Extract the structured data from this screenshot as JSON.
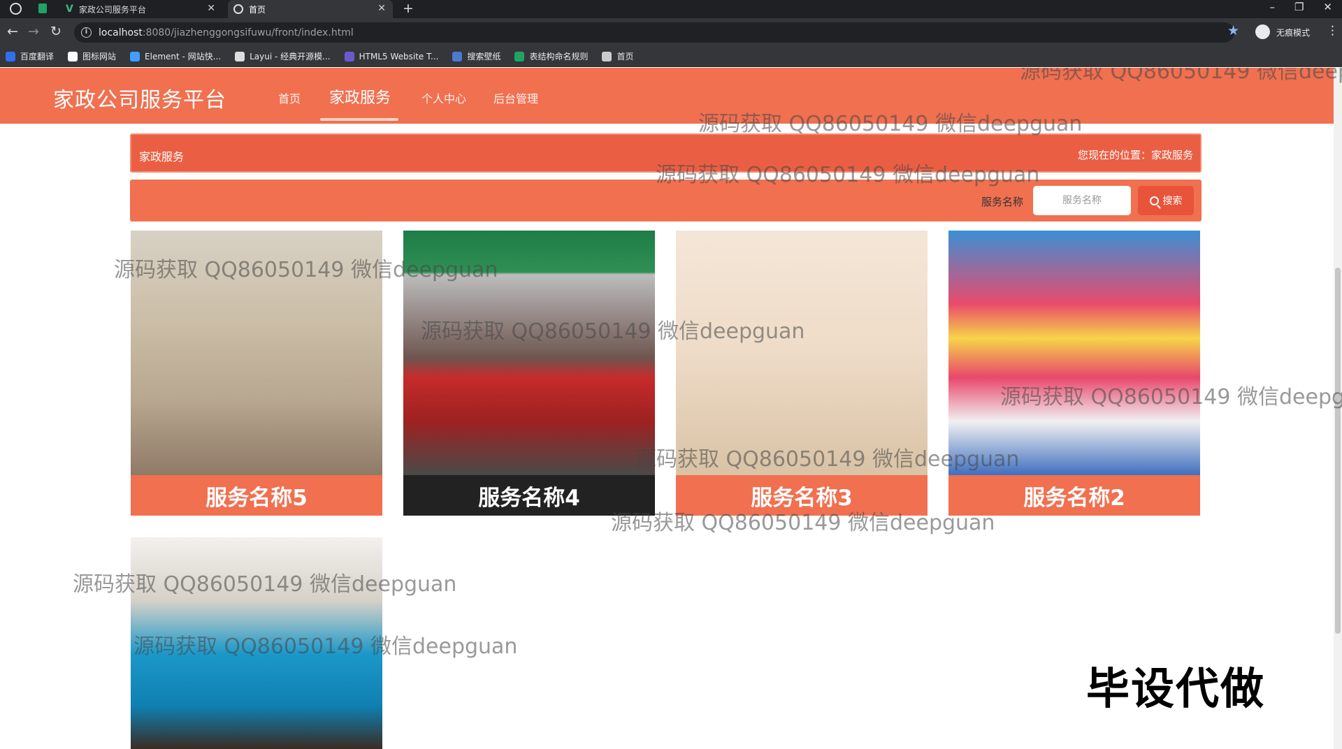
{
  "browser": {
    "tabs": [
      {
        "title": "家政公司服务平台"
      },
      {
        "title": "首页"
      }
    ],
    "url": {
      "host": "localhost",
      "rest": ":8080/jiazhenggongsifuwu/front/index.html"
    },
    "incognito_label": "无痕模式",
    "bookmarks": [
      {
        "label": "百度翻译",
        "color": "#2f6ff0"
      },
      {
        "label": "图标网站",
        "color": "#ffffff"
      },
      {
        "label": "Element - 网站快...",
        "color": "#409eff"
      },
      {
        "label": "Layui - 经典开源模...",
        "color": "#dddddd"
      },
      {
        "label": "HTML5 Website T...",
        "color": "#6a5acd"
      },
      {
        "label": "搜索壁纸",
        "color": "#4a7bd0"
      },
      {
        "label": "表结构命名规则",
        "color": "#1fa463"
      },
      {
        "label": "首页",
        "color": "#cccccc"
      }
    ]
  },
  "site": {
    "title": "家政公司服务平台",
    "brand_color": "#f07050",
    "nav": [
      {
        "label": "首页"
      },
      {
        "label": "家政服务",
        "active": true
      },
      {
        "label": "个人中心"
      },
      {
        "label": "后台管理"
      }
    ]
  },
  "breadcrumb": {
    "title": "家政服务",
    "location": "您现在的位置：家政服务"
  },
  "search": {
    "label": "服务名称",
    "placeholder": "服务名称",
    "button": "搜索"
  },
  "services": [
    {
      "name": "服务名称5"
    },
    {
      "name": "服务名称4"
    },
    {
      "name": "服务名称3"
    },
    {
      "name": "服务名称2"
    },
    {
      "name": ""
    }
  ],
  "watermark_text": "源码获取 QQ86050149 微信deepguan",
  "promo_text": "毕设代做"
}
